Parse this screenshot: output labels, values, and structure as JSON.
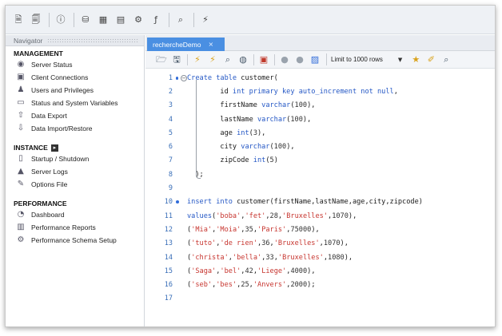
{
  "navigator": {
    "title": "Navigator",
    "management": {
      "title": "MANAGEMENT",
      "items": [
        {
          "label": "Server Status",
          "icon": "server-status-icon"
        },
        {
          "label": "Client Connections",
          "icon": "client-connections-icon"
        },
        {
          "label": "Users and Privileges",
          "icon": "users-privileges-icon"
        },
        {
          "label": "Status and System Variables",
          "icon": "system-variables-icon"
        },
        {
          "label": "Data Export",
          "icon": "data-export-icon"
        },
        {
          "label": "Data Import/Restore",
          "icon": "data-import-icon"
        }
      ]
    },
    "instance": {
      "title": "INSTANCE",
      "items": [
        {
          "label": "Startup / Shutdown",
          "icon": "startup-shutdown-icon"
        },
        {
          "label": "Server Logs",
          "icon": "server-logs-icon"
        },
        {
          "label": "Options File",
          "icon": "options-file-icon"
        }
      ]
    },
    "performance": {
      "title": "PERFORMANCE",
      "items": [
        {
          "label": "Dashboard",
          "icon": "dashboard-icon"
        },
        {
          "label": "Performance Reports",
          "icon": "performance-reports-icon"
        },
        {
          "label": "Performance Schema Setup",
          "icon": "performance-schema-icon"
        }
      ]
    }
  },
  "editor": {
    "tab_label": "rechercheDemo",
    "tab_close": "×",
    "limit_label": "Limit to 1000 rows",
    "lines": [
      {
        "n": "1",
        "marker": "bullet",
        "fold": true,
        "parts": [
          [
            "kw",
            "Create table "
          ],
          [
            "src",
            "customer("
          ]
        ]
      },
      {
        "n": "2",
        "parts": [
          [
            "src",
            "        id "
          ],
          [
            "kw",
            "int primary key auto_increment not null"
          ],
          [
            "src",
            ","
          ]
        ]
      },
      {
        "n": "3",
        "parts": [
          [
            "src",
            "        firstName "
          ],
          [
            "kw",
            "varchar"
          ],
          [
            "src",
            "("
          ],
          [
            "num",
            "100"
          ],
          [
            "src",
            "),"
          ]
        ]
      },
      {
        "n": "4",
        "parts": [
          [
            "src",
            "        lastName "
          ],
          [
            "kw",
            "varchar"
          ],
          [
            "src",
            "("
          ],
          [
            "num",
            "100"
          ],
          [
            "src",
            "),"
          ]
        ]
      },
      {
        "n": "5",
        "parts": [
          [
            "src",
            "        age "
          ],
          [
            "kw",
            "int"
          ],
          [
            "src",
            "("
          ],
          [
            "num",
            "3"
          ],
          [
            "src",
            "),"
          ]
        ]
      },
      {
        "n": "6",
        "parts": [
          [
            "src",
            "        city "
          ],
          [
            "kw",
            "varchar"
          ],
          [
            "src",
            "("
          ],
          [
            "num",
            "100"
          ],
          [
            "src",
            "),"
          ]
        ]
      },
      {
        "n": "7",
        "parts": [
          [
            "src",
            "        zipCode "
          ],
          [
            "kw",
            "int"
          ],
          [
            "src",
            "("
          ],
          [
            "num",
            "5"
          ],
          [
            "src",
            ")"
          ]
        ]
      },
      {
        "n": "8",
        "parts": [
          [
            "src",
            "  );"
          ]
        ]
      },
      {
        "n": "9",
        "parts": []
      },
      {
        "n": "10",
        "marker": "bullet",
        "parts": [
          [
            "kw",
            "insert into "
          ],
          [
            "src",
            "customer(firstName,lastName,age,city,zipcode)"
          ]
        ]
      },
      {
        "n": "11",
        "parts": [
          [
            "kw",
            "values"
          ],
          [
            "src",
            "("
          ],
          [
            "str",
            "'boba'"
          ],
          [
            "src",
            ","
          ],
          [
            "str",
            "'fet'"
          ],
          [
            "src",
            ","
          ],
          [
            "num",
            "28"
          ],
          [
            "src",
            ","
          ],
          [
            "str",
            "'Bruxelles'"
          ],
          [
            "src",
            ","
          ],
          [
            "num",
            "1070"
          ],
          [
            "src",
            "),"
          ]
        ]
      },
      {
        "n": "12",
        "parts": [
          [
            "src",
            "("
          ],
          [
            "str",
            "'Mia'"
          ],
          [
            "src",
            ","
          ],
          [
            "str",
            "'Moia'"
          ],
          [
            "src",
            ","
          ],
          [
            "num",
            "35"
          ],
          [
            "src",
            ","
          ],
          [
            "str",
            "'Paris'"
          ],
          [
            "src",
            ","
          ],
          [
            "num",
            "75000"
          ],
          [
            "src",
            "),"
          ]
        ]
      },
      {
        "n": "13",
        "parts": [
          [
            "src",
            "("
          ],
          [
            "str",
            "'tuto'"
          ],
          [
            "src",
            ","
          ],
          [
            "str",
            "'de rien'"
          ],
          [
            "src",
            ","
          ],
          [
            "num",
            "36"
          ],
          [
            "src",
            ","
          ],
          [
            "str",
            "'Bruxelles'"
          ],
          [
            "src",
            ","
          ],
          [
            "num",
            "1070"
          ],
          [
            "src",
            "),"
          ]
        ]
      },
      {
        "n": "14",
        "parts": [
          [
            "src",
            "("
          ],
          [
            "str",
            "'christa'"
          ],
          [
            "src",
            ","
          ],
          [
            "str",
            "'bella'"
          ],
          [
            "src",
            ","
          ],
          [
            "num",
            "33"
          ],
          [
            "src",
            ","
          ],
          [
            "str",
            "'Bruxelles'"
          ],
          [
            "src",
            ","
          ],
          [
            "num",
            "1080"
          ],
          [
            "src",
            "),"
          ]
        ]
      },
      {
        "n": "15",
        "parts": [
          [
            "src",
            "("
          ],
          [
            "str",
            "'Saga'"
          ],
          [
            "src",
            ","
          ],
          [
            "str",
            "'bel'"
          ],
          [
            "src",
            ","
          ],
          [
            "num",
            "42"
          ],
          [
            "src",
            ","
          ],
          [
            "str",
            "'Liege'"
          ],
          [
            "src",
            ","
          ],
          [
            "num",
            "4000"
          ],
          [
            "src",
            "),"
          ]
        ]
      },
      {
        "n": "16",
        "parts": [
          [
            "src",
            "("
          ],
          [
            "str",
            "'seb'"
          ],
          [
            "src",
            ","
          ],
          [
            "str",
            "'bes'"
          ],
          [
            "src",
            ","
          ],
          [
            "num",
            "25"
          ],
          [
            "src",
            ","
          ],
          [
            "str",
            "'Anvers'"
          ],
          [
            "src",
            ","
          ],
          [
            "num",
            "2000"
          ],
          [
            "src",
            ");"
          ]
        ]
      },
      {
        "n": "17",
        "parts": []
      }
    ]
  },
  "colors": {
    "accent": "#4a8fe2",
    "keyword": "#2457c5",
    "string": "#c7352f",
    "line_number": "#3a6fb8"
  }
}
